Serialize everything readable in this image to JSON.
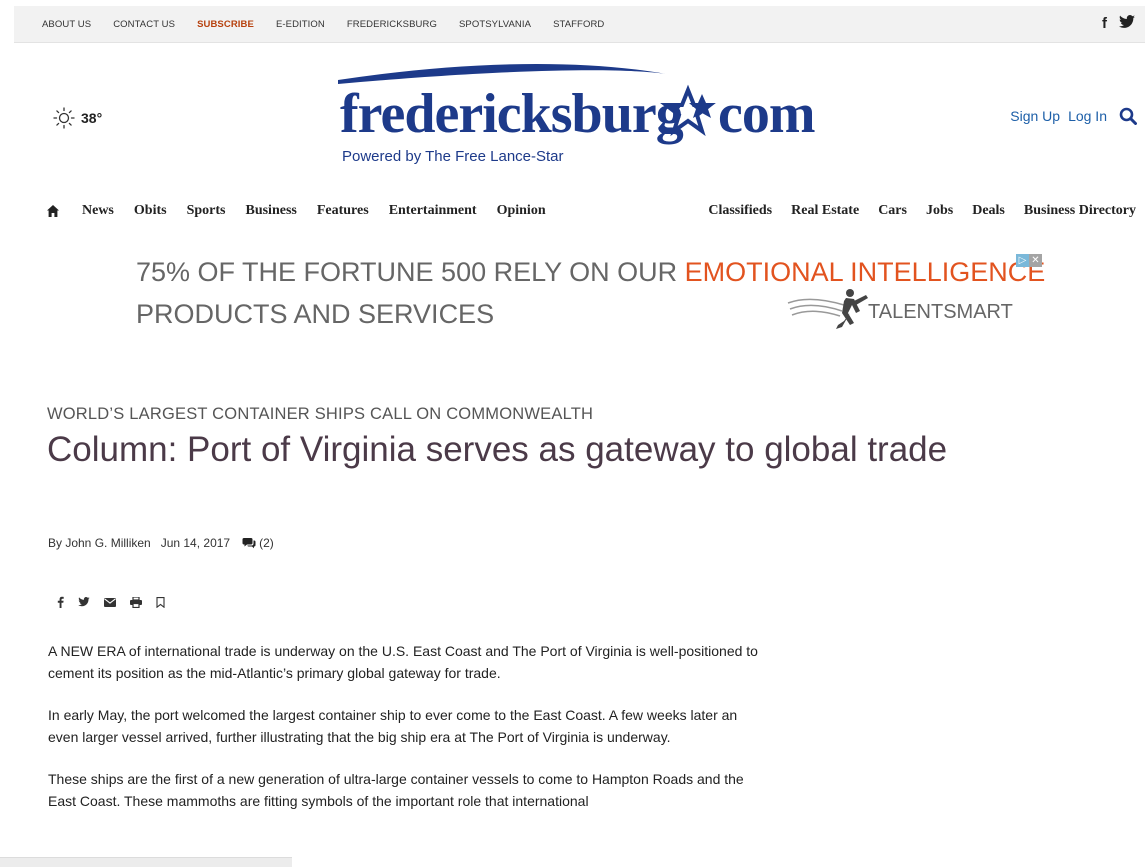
{
  "topbar": {
    "links": [
      "ABOUT US",
      "CONTACT US",
      "SUBSCRIBE",
      "E-EDITION",
      "FREDERICKSBURG",
      "SPOTSYLVANIA",
      "STAFFORD"
    ],
    "social": [
      "facebook-icon",
      "twitter-icon"
    ]
  },
  "weather": {
    "temp": "38°",
    "icon": "sun-icon"
  },
  "logo": {
    "word": "fredericksburg",
    "com": "com",
    "tagline": "Powered by The Free Lance-Star"
  },
  "account": {
    "signup": "Sign Up",
    "login": "Log In"
  },
  "nav": {
    "left": [
      "News",
      "Obits",
      "Sports",
      "Business",
      "Features",
      "Entertainment",
      "Opinion"
    ],
    "right": [
      "Classifieds",
      "Real Estate",
      "Cars",
      "Jobs",
      "Deals",
      "Business Directory"
    ]
  },
  "ad": {
    "line1_prefix": "75% OF THE FORTUNE 500 RELY ON OUR ",
    "line1_highlight": "EMOTIONAL INTELLIGENCE",
    "line2": "PRODUCTS AND SERVICES",
    "brand": "TALENTSMART",
    "accent": "#e2531f"
  },
  "article": {
    "kicker": "WORLD’S LARGEST CONTAINER SHIPS CALL ON COMMONWEALTH",
    "headline": "Column: Port of Virginia serves as gateway to global trade",
    "author": "By John G. Milliken",
    "date": "Jun 14, 2017",
    "comments": "(2)",
    "share_icons": [
      "facebook-icon",
      "twitter-icon",
      "email-icon",
      "print-icon",
      "bookmark-icon"
    ],
    "paragraphs": [
      "A NEW ERA of international trade is underway on the U.S. East Coast and The Port of Virginia is well-positioned to cement its position as the mid-Atlantic’s primary global gateway for trade.",
      "In early May, the port welcomed the largest container ship to ever come to the East Coast. A few weeks later an even larger vessel arrived, further illustrating that the big ship era at The Port of Virginia is underway.",
      "These ships are the first of a new generation of ultra-large container vessels to come to Hampton Roads and the East Coast. These mammoths are fitting symbols of the important role that international"
    ]
  },
  "colors": {
    "brand_blue": "#1d3a8a",
    "link_blue": "#1d5fa8",
    "subscribe": "#b7410e",
    "headline": "#4b3a48"
  }
}
